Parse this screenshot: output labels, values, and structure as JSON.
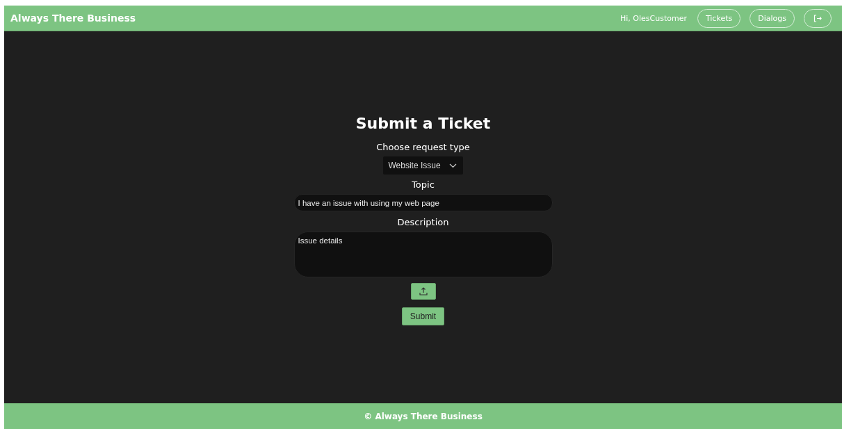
{
  "header": {
    "brand": "Always There Business",
    "greeting": "Hi, OlesCustomer",
    "nav": [
      "Tickets",
      "Dialogs"
    ]
  },
  "form": {
    "title": "Submit a Ticket",
    "type_label": "Choose request type",
    "type_value": "Website Issue",
    "topic_label": "Topic",
    "topic_value": "I have an issue with using my web page",
    "description_label": "Description",
    "description_value": "Issue details",
    "submit": "Submit"
  },
  "footer": {
    "text": "© Always There Business"
  }
}
